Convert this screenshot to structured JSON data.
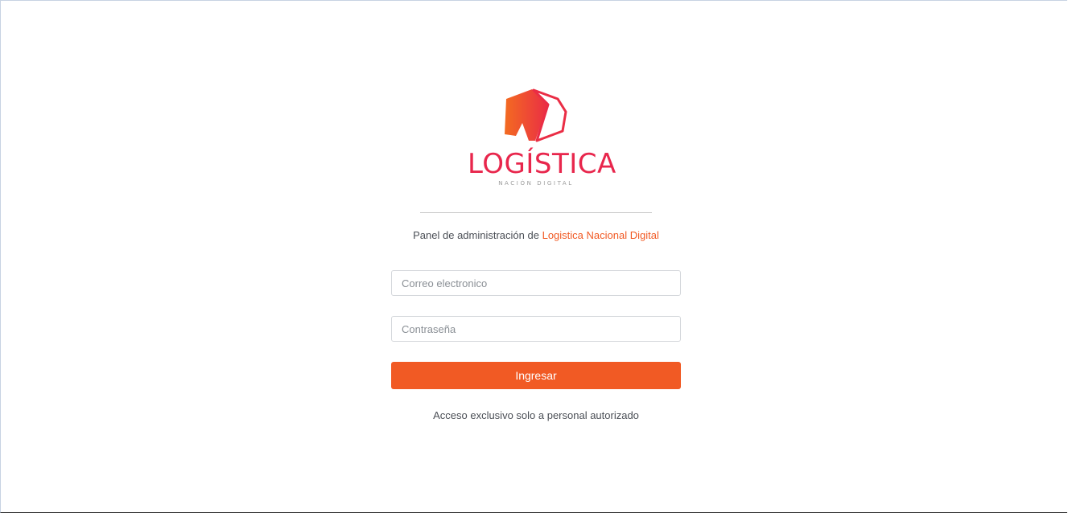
{
  "brand": {
    "name": "LOGÍSTICA",
    "tagline": "NACIÓN DIGITAL",
    "primary_color": "#e8264c",
    "accent_color": "#f15a24",
    "logo_icon": "geometric-arrow-logo-icon"
  },
  "panel": {
    "subtitle_prefix": "Panel de administración de",
    "subtitle_brand": "Logistica Nacional Digital"
  },
  "form": {
    "email_placeholder": "Correo electronico",
    "email_value": "",
    "password_placeholder": "Contraseña",
    "password_value": "",
    "submit_label": "Ingresar"
  },
  "footer": {
    "note": "Acceso exclusivo solo a personal autorizado"
  }
}
